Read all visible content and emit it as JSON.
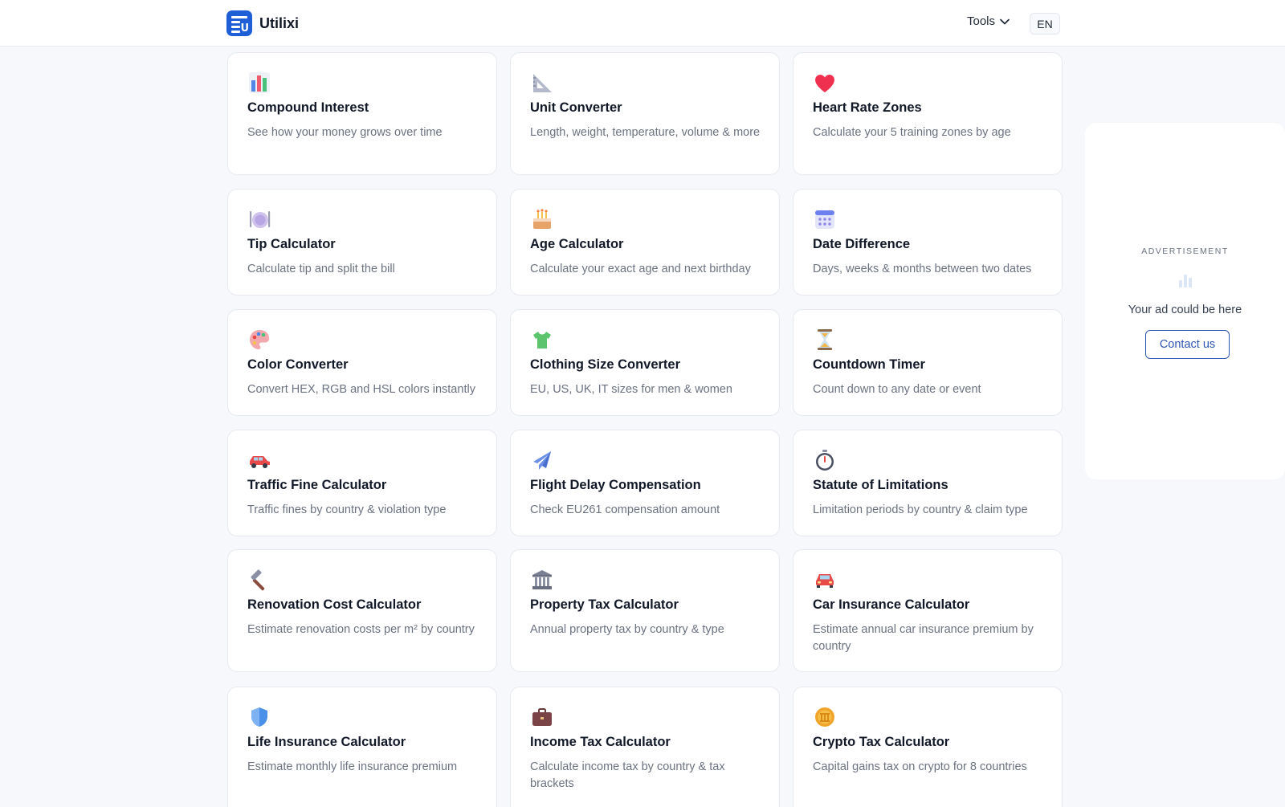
{
  "header": {
    "brand": "Utilixi",
    "tools_label": "Tools",
    "lang_label": "EN"
  },
  "tools": [
    {
      "icon": "bar-chart-icon",
      "title": "Compound Interest",
      "desc": "See how your money grows over time"
    },
    {
      "icon": "triangular-ruler-icon",
      "title": "Unit Converter",
      "desc": "Length, weight, temperature, volume & more"
    },
    {
      "icon": "heart-icon",
      "title": "Heart Rate Zones",
      "desc": "Calculate your 5 training zones by age"
    },
    {
      "icon": "plate-cutlery-icon",
      "title": "Tip Calculator",
      "desc": "Calculate tip and split the bill"
    },
    {
      "icon": "birthday-cake-icon",
      "title": "Age Calculator",
      "desc": "Calculate your exact age and next birthday"
    },
    {
      "icon": "calendar-icon",
      "title": "Date Difference",
      "desc": "Days, weeks & months between two dates"
    },
    {
      "icon": "palette-icon",
      "title": "Color Converter",
      "desc": "Convert HEX, RGB and HSL colors instantly"
    },
    {
      "icon": "tshirt-icon",
      "title": "Clothing Size Converter",
      "desc": "EU, US, UK, IT sizes for men & women"
    },
    {
      "icon": "hourglass-icon",
      "title": "Countdown Timer",
      "desc": "Count down to any date or event"
    },
    {
      "icon": "car-icon",
      "title": "Traffic Fine Calculator",
      "desc": "Traffic fines by country & violation type"
    },
    {
      "icon": "airplane-icon",
      "title": "Flight Delay Compensation",
      "desc": "Check EU261 compensation amount"
    },
    {
      "icon": "stopwatch-icon",
      "title": "Statute of Limitations",
      "desc": "Limitation periods by country & claim type"
    },
    {
      "icon": "hammer-icon",
      "title": "Renovation Cost Calculator",
      "desc": "Estimate renovation costs per m² by country"
    },
    {
      "icon": "bank-building-icon",
      "title": "Property Tax Calculator",
      "desc": "Annual property tax by country & type"
    },
    {
      "icon": "car-front-icon",
      "title": "Car Insurance Calculator",
      "desc": "Estimate annual car insurance premium by country"
    },
    {
      "icon": "shield-icon",
      "title": "Life Insurance Calculator",
      "desc": "Estimate monthly life insurance premium"
    },
    {
      "icon": "briefcase-icon",
      "title": "Income Tax Calculator",
      "desc": "Calculate income tax by country & tax brackets"
    },
    {
      "icon": "coin-icon",
      "title": "Crypto Tax Calculator",
      "desc": "Capital gains tax on crypto for 8 countries"
    }
  ],
  "ad": {
    "label": "ADVERTISEMENT",
    "icon": "bar-chart-icon",
    "text": "Your ad could be here",
    "button": "Contact us"
  },
  "colors": {
    "brand": "#1e5fd8",
    "background": "#f6f8fb",
    "ad_button": "#2f56b3"
  }
}
